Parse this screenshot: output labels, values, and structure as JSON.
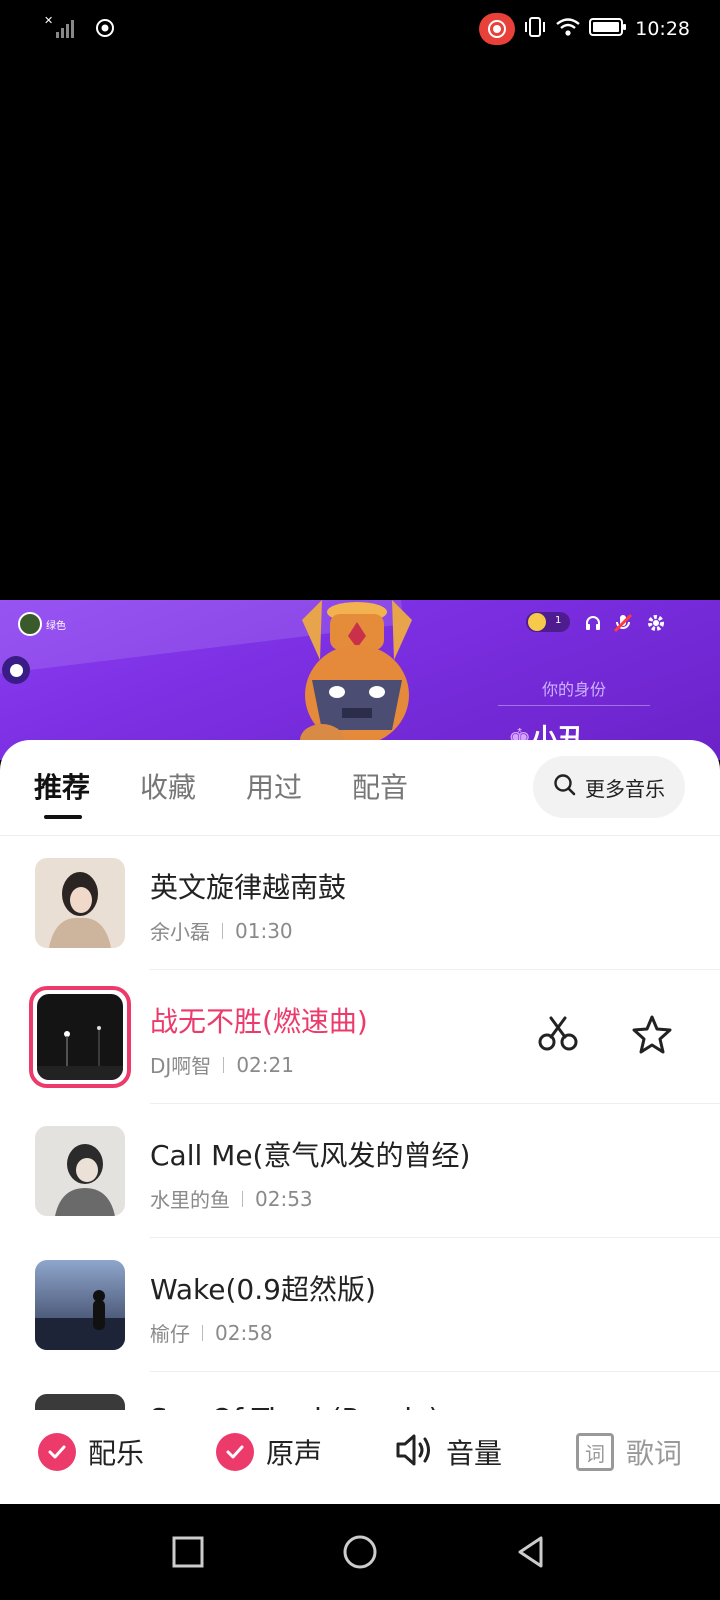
{
  "status_bar": {
    "time": "10:28",
    "icons": [
      "signal-off-icon",
      "hotspot-icon",
      "screen-record-icon",
      "vibrate-icon",
      "wifi-icon",
      "battery-icon"
    ]
  },
  "game": {
    "player_name": "绿色",
    "coin_count": "1",
    "identity_label": "你的身份",
    "identity_role": "小丑",
    "colors": {
      "bg_start": "#8a3cf2",
      "bg_end": "#6b22c8"
    }
  },
  "tabs": [
    {
      "label": "推荐",
      "active": true
    },
    {
      "label": "收藏",
      "active": false
    },
    {
      "label": "用过",
      "active": false
    },
    {
      "label": "配音",
      "active": false
    }
  ],
  "more_music": {
    "label": "更多音乐",
    "icon": "search-icon"
  },
  "songs": [
    {
      "title": "英文旋律越南鼓",
      "artist": "余小磊",
      "duration": "01:30",
      "active": false
    },
    {
      "title": "战无不胜(燃速曲)",
      "artist": "DJ啊智",
      "duration": "02:21",
      "active": true
    },
    {
      "title": "Call Me(意气风发的曾经)",
      "artist": "水里的鱼",
      "duration": "02:53",
      "active": false
    },
    {
      "title": "Wake(0.9超然版)",
      "artist": "榆仔",
      "duration": "02:58",
      "active": false
    },
    {
      "title": "Sea Of Tired (Remix)",
      "artist": "",
      "duration": "",
      "active": false
    }
  ],
  "controls": {
    "music": "配乐",
    "original": "原声",
    "volume": "音量",
    "lyrics": "歌词",
    "lyrics_icon_char": "词"
  },
  "colors": {
    "accent": "#ec3a6b",
    "tab_active": "#111111",
    "muted": "#8a8a8a"
  }
}
